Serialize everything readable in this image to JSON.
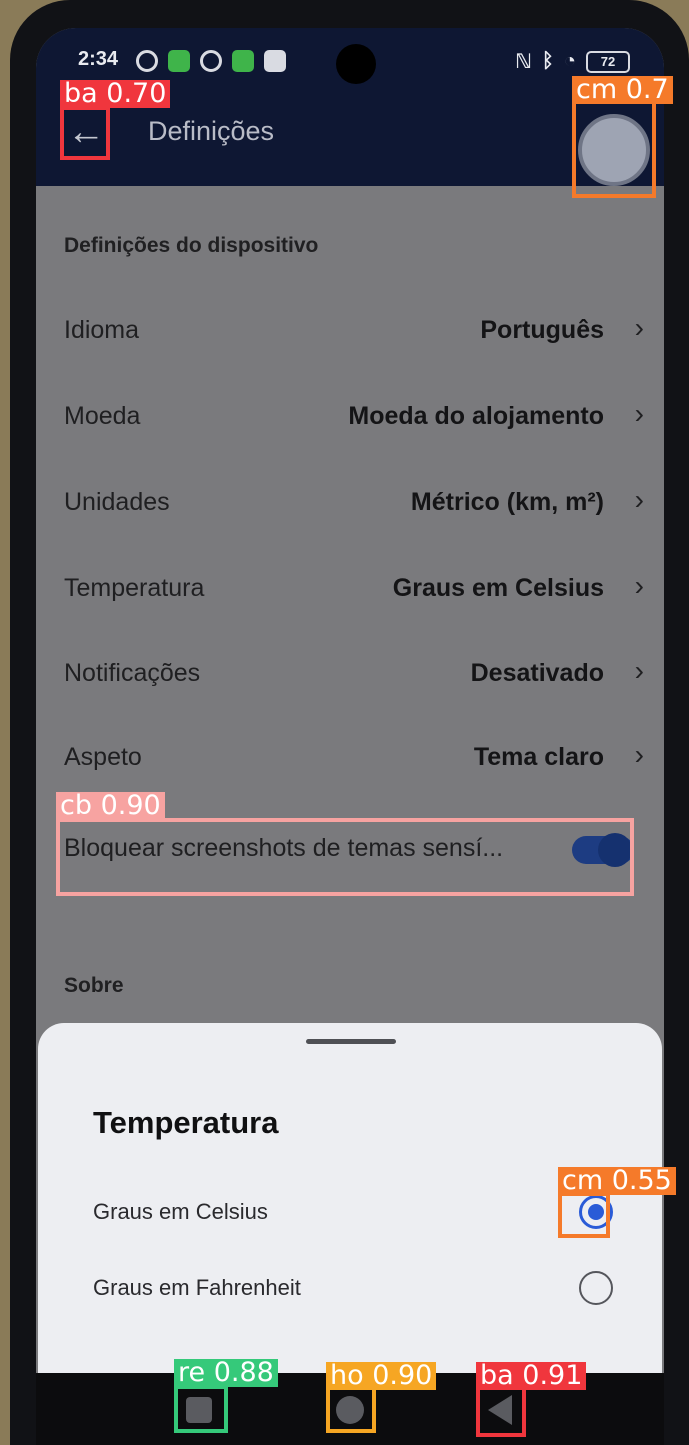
{
  "status_bar": {
    "time": "2:34",
    "battery": "72"
  },
  "header": {
    "title": "Definições"
  },
  "device_section": {
    "title": "Definições do dispositivo",
    "items": [
      {
        "label": "Idioma",
        "value": "Português"
      },
      {
        "label": "Moeda",
        "value": "Moeda do alojamento"
      },
      {
        "label": "Unidades",
        "value": "Métrico (km, m²)"
      },
      {
        "label": "Temperatura",
        "value": "Graus em Celsius"
      },
      {
        "label": "Notificações",
        "value": "Desativado"
      },
      {
        "label": "Aspeto",
        "value": "Tema claro"
      }
    ],
    "toggle": {
      "label": "Bloquear screenshots de temas sensí...",
      "enabled": true
    }
  },
  "about_section": {
    "title": "Sobre"
  },
  "sheet": {
    "title": "Temperatura",
    "options": [
      {
        "label": "Graus em Celsius",
        "selected": true
      },
      {
        "label": "Graus em Fahrenheit",
        "selected": false
      }
    ]
  },
  "detections": [
    {
      "label": "ba 0.70",
      "color": "#f0363d"
    },
    {
      "label": "cm 0.7",
      "color": "#f57a2a"
    },
    {
      "label": "cb 0.90",
      "color": "#f7a3a1"
    },
    {
      "label": "cm 0.55",
      "color": "#f57a2a"
    },
    {
      "label": "re 0.88",
      "color": "#35c97a"
    },
    {
      "label": "ho 0.90",
      "color": "#f6a623"
    },
    {
      "label": "ba 0.91",
      "color": "#f0363d"
    }
  ]
}
